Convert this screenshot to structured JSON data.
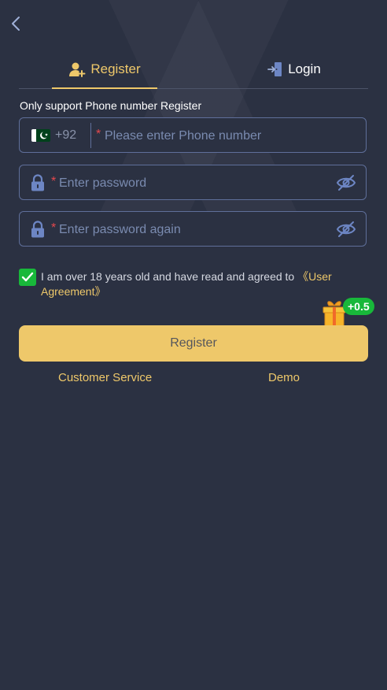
{
  "tabs": {
    "register_label": "Register",
    "login_label": "Login"
  },
  "hint": "Only support Phone number Register",
  "phone": {
    "country_code": "+92",
    "required_mark": "*",
    "placeholder": "Please enter Phone number"
  },
  "password": {
    "required_mark": "*",
    "placeholder": "Enter password"
  },
  "password_again": {
    "required_mark": "*",
    "placeholder": "Enter password again"
  },
  "agreement": {
    "checked": true,
    "text": "I am over 18 years old and have read and agreed to ",
    "link_text": "《User Agreement》"
  },
  "bonus": {
    "label": "+0.5"
  },
  "register_button": "Register",
  "links": {
    "customer_service": "Customer Service",
    "demo": "Demo"
  },
  "colors": {
    "background": "#2b3142",
    "accent": "#eec86a",
    "input_border": "#5f6f9a",
    "check_green": "#18b83a",
    "required_red": "#e5484d"
  },
  "icons": {
    "back": "chevron-left-icon",
    "register_tab": "user-plus-icon",
    "login_tab": "door-login-icon",
    "flag": "pakistan-flag-icon",
    "lock": "lock-icon",
    "eye": "eye-off-icon",
    "check": "check-icon",
    "gift": "gift-icon"
  }
}
